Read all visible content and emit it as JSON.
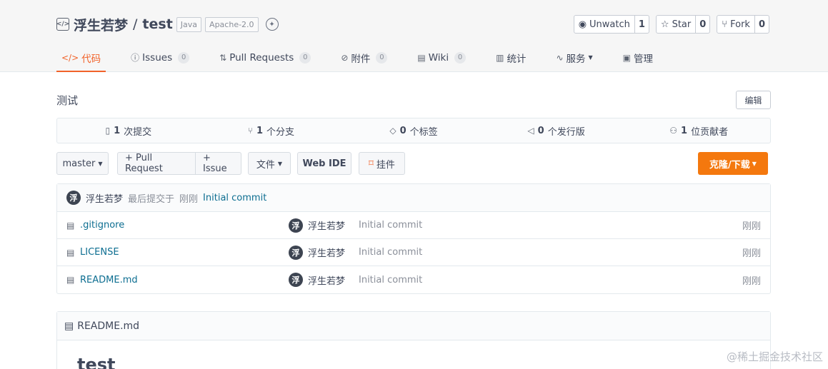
{
  "repo": {
    "owner": "浮生若梦",
    "separator": "/",
    "name": "test",
    "tags": [
      "Java",
      "Apache-2.0"
    ]
  },
  "actions": [
    {
      "icon": "eye-icon",
      "label": "Unwatch",
      "count": "1"
    },
    {
      "icon": "star-icon",
      "label": "Star",
      "count": "0"
    },
    {
      "icon": "fork-icon",
      "label": "Fork",
      "count": "0"
    }
  ],
  "tabs": [
    {
      "icon": "code-icon",
      "label": "代码",
      "count": "",
      "active": true
    },
    {
      "icon": "issues-icon",
      "label": "Issues",
      "count": "0"
    },
    {
      "icon": "pull-request-icon",
      "label": "Pull Requests",
      "count": "0"
    },
    {
      "icon": "attachment-icon",
      "label": "附件",
      "count": "0"
    },
    {
      "icon": "wiki-icon",
      "label": "Wiki",
      "count": "0"
    },
    {
      "icon": "stats-icon",
      "label": "统计",
      "count": ""
    },
    {
      "icon": "service-icon",
      "label": "服务",
      "count": ""
    },
    {
      "icon": "manage-icon",
      "label": "管理",
      "count": ""
    }
  ],
  "description": "测试",
  "edit_label": "编辑",
  "stats": [
    {
      "icon": "commit-icon",
      "value": "1",
      "label": "次提交"
    },
    {
      "icon": "branch-icon",
      "value": "1",
      "label": "个分支"
    },
    {
      "icon": "tag-icon",
      "value": "0",
      "label": "个标签"
    },
    {
      "icon": "release-icon",
      "value": "0",
      "label": "个发行版"
    },
    {
      "icon": "contributors-icon",
      "value": "1",
      "label": "位贡献者"
    }
  ],
  "toolbar": {
    "branch": "master",
    "pull_request": "+ Pull Request",
    "issue": "+ Issue",
    "file": "文件",
    "web_ide": "Web IDE",
    "pin": "挂件",
    "clone": "克隆/下载"
  },
  "last_commit": {
    "avatar": "浮",
    "author": "浮生若梦",
    "prefix": "最后提交于",
    "time": "刚刚",
    "message": "Initial commit"
  },
  "files": [
    {
      "name": ".gitignore",
      "avatar": "浮",
      "author": "浮生若梦",
      "message": "Initial commit",
      "time": "刚刚"
    },
    {
      "name": "LICENSE",
      "avatar": "浮",
      "author": "浮生若梦",
      "message": "Initial commit",
      "time": "刚刚"
    },
    {
      "name": "README.md",
      "avatar": "浮",
      "author": "浮生若梦",
      "message": "Initial commit",
      "time": "刚刚"
    }
  ],
  "readme": {
    "filename": "README.md",
    "heading": "test"
  },
  "watermark": "@稀土掘金技术社区"
}
